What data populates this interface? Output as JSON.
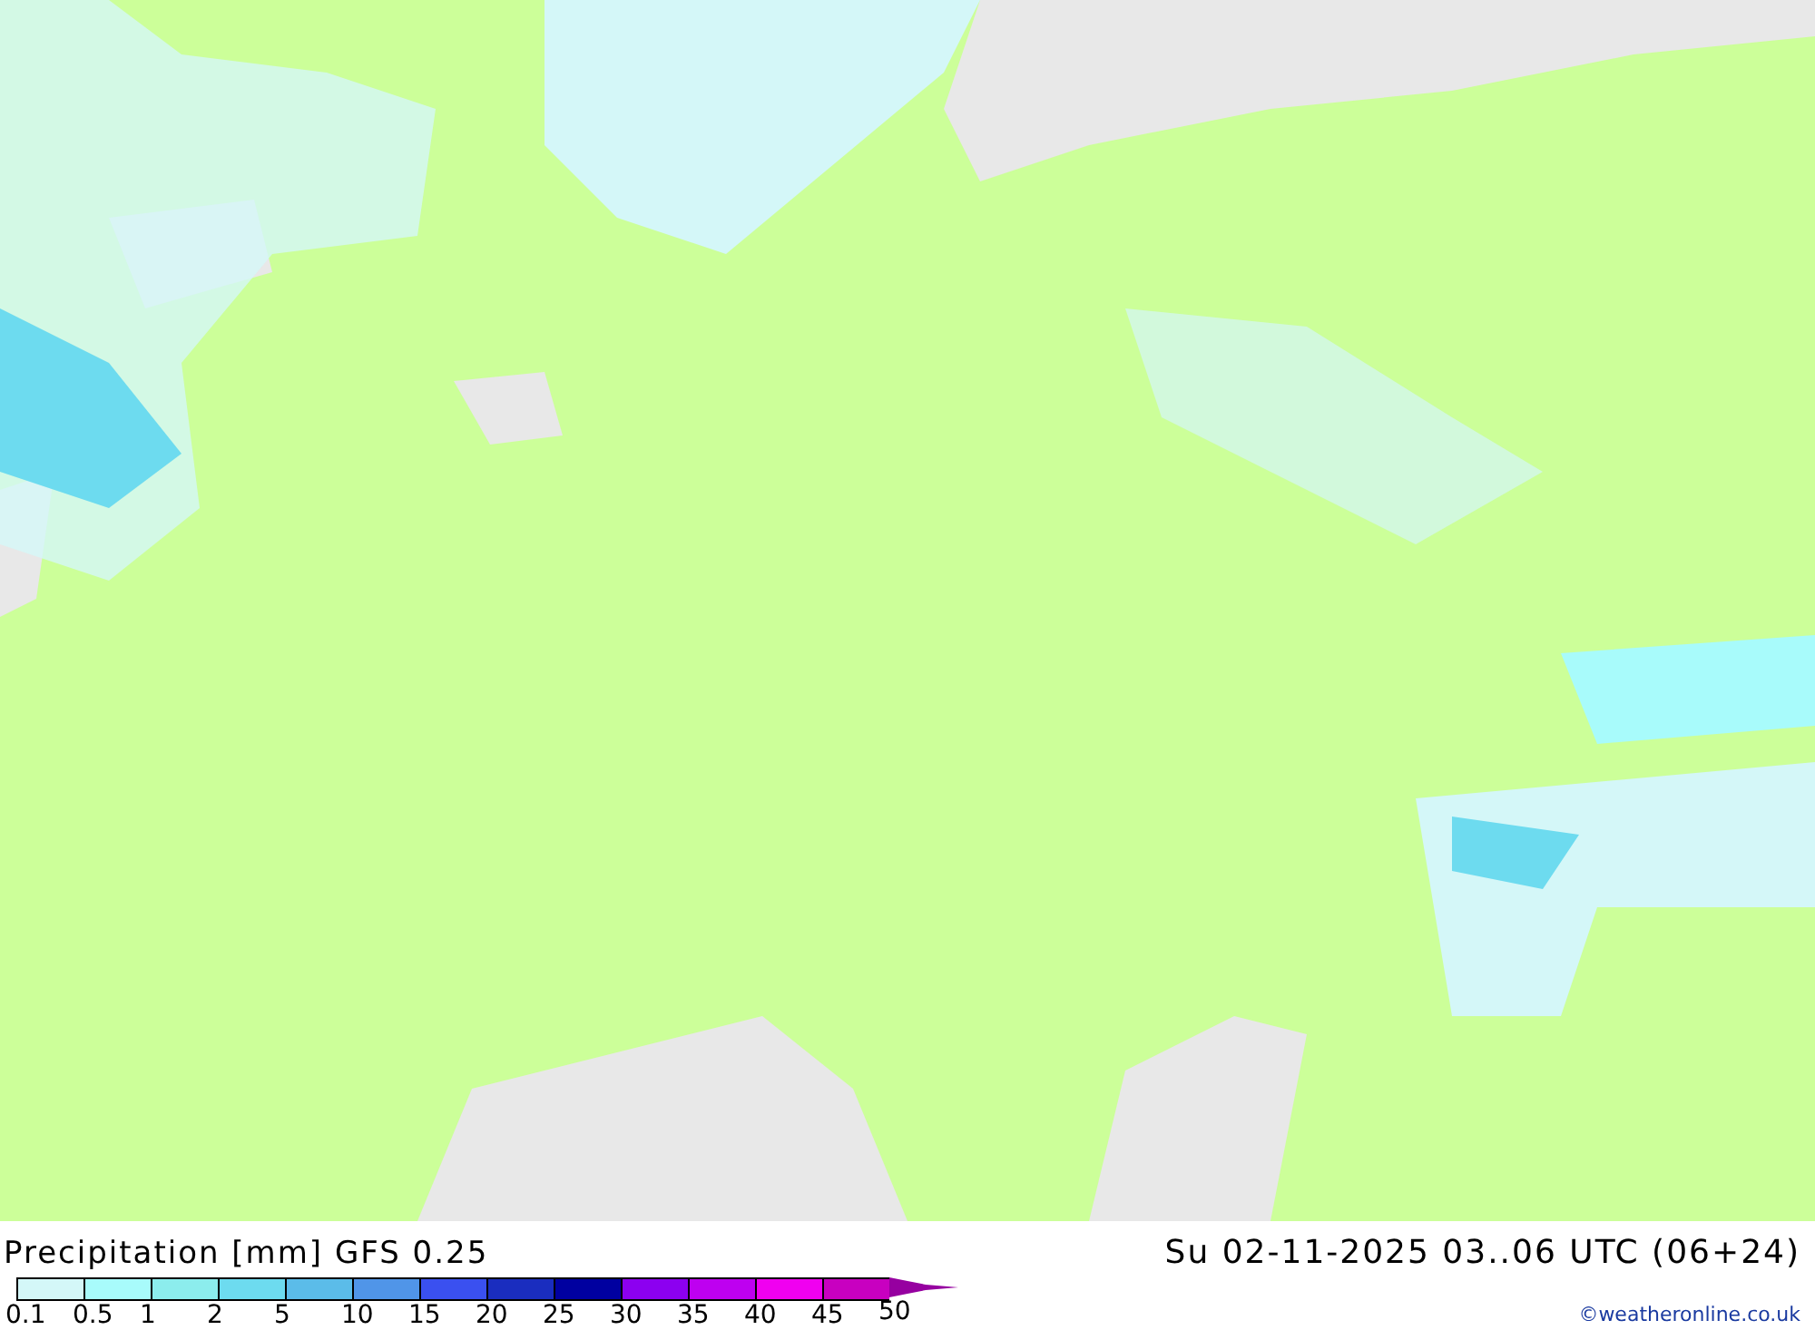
{
  "legend": {
    "title": "Precipitation [mm] GFS 0.25",
    "scale": [
      {
        "label": "0.1",
        "color": "#d4f7f8"
      },
      {
        "label": "0.5",
        "color": "#a8fbfb"
      },
      {
        "label": "1",
        "color": "#8ceded"
      },
      {
        "label": "2",
        "color": "#6ddbef"
      },
      {
        "label": "5",
        "color": "#5bbce9"
      },
      {
        "label": "10",
        "color": "#5095e8"
      },
      {
        "label": "15",
        "color": "#3a50f0"
      },
      {
        "label": "20",
        "color": "#1a2dbf"
      },
      {
        "label": "25",
        "color": "#0000a0"
      },
      {
        "label": "30",
        "color": "#8c00f0"
      },
      {
        "label": "35",
        "color": "#be00f0"
      },
      {
        "label": "40",
        "color": "#f000f0"
      },
      {
        "label": "45",
        "color": "#c800c0"
      },
      {
        "label": "50",
        "color": "#9600a0"
      }
    ]
  },
  "valid_time": "Su 02-11-2025 03..06 UTC (06+24)",
  "credit": "©weatheronline.co.uk"
}
